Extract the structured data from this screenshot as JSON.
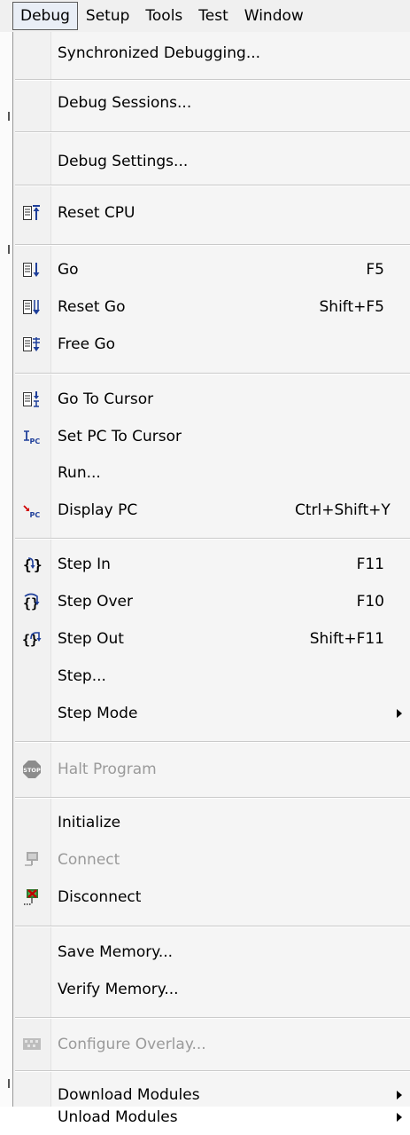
{
  "menubar": {
    "items": [
      "Debug",
      "Setup",
      "Tools",
      "Test",
      "Window"
    ]
  },
  "menu": {
    "synchronized_debugging": "Synchronized Debugging...",
    "debug_sessions": "Debug Sessions...",
    "debug_settings": "Debug Settings...",
    "reset_cpu": "Reset CPU",
    "go": "Go",
    "go_shortcut": "F5",
    "reset_go": "Reset Go",
    "reset_go_shortcut": "Shift+F5",
    "free_go": "Free Go",
    "go_to_cursor": "Go To Cursor",
    "set_pc_to_cursor": "Set PC To Cursor",
    "run": "Run...",
    "display_pc": "Display PC",
    "display_pc_shortcut": "Ctrl+Shift+Y",
    "step_in": "Step In",
    "step_in_shortcut": "F11",
    "step_over": "Step Over",
    "step_over_shortcut": "F10",
    "step_out": "Step Out",
    "step_out_shortcut": "Shift+F11",
    "step": "Step...",
    "step_mode": "Step Mode",
    "halt_program": "Halt Program",
    "initialize": "Initialize",
    "connect": "Connect",
    "disconnect": "Disconnect",
    "save_memory": "Save Memory...",
    "verify_memory": "Verify Memory...",
    "configure_overlay": "Configure Overlay...",
    "download_modules": "Download Modules",
    "unload_modules": "Unload Modules"
  },
  "colors": {
    "disabled_text": "#9a9a9a",
    "stop_icon": "#8c8c8c",
    "disconnect_icon": "#c00000"
  }
}
